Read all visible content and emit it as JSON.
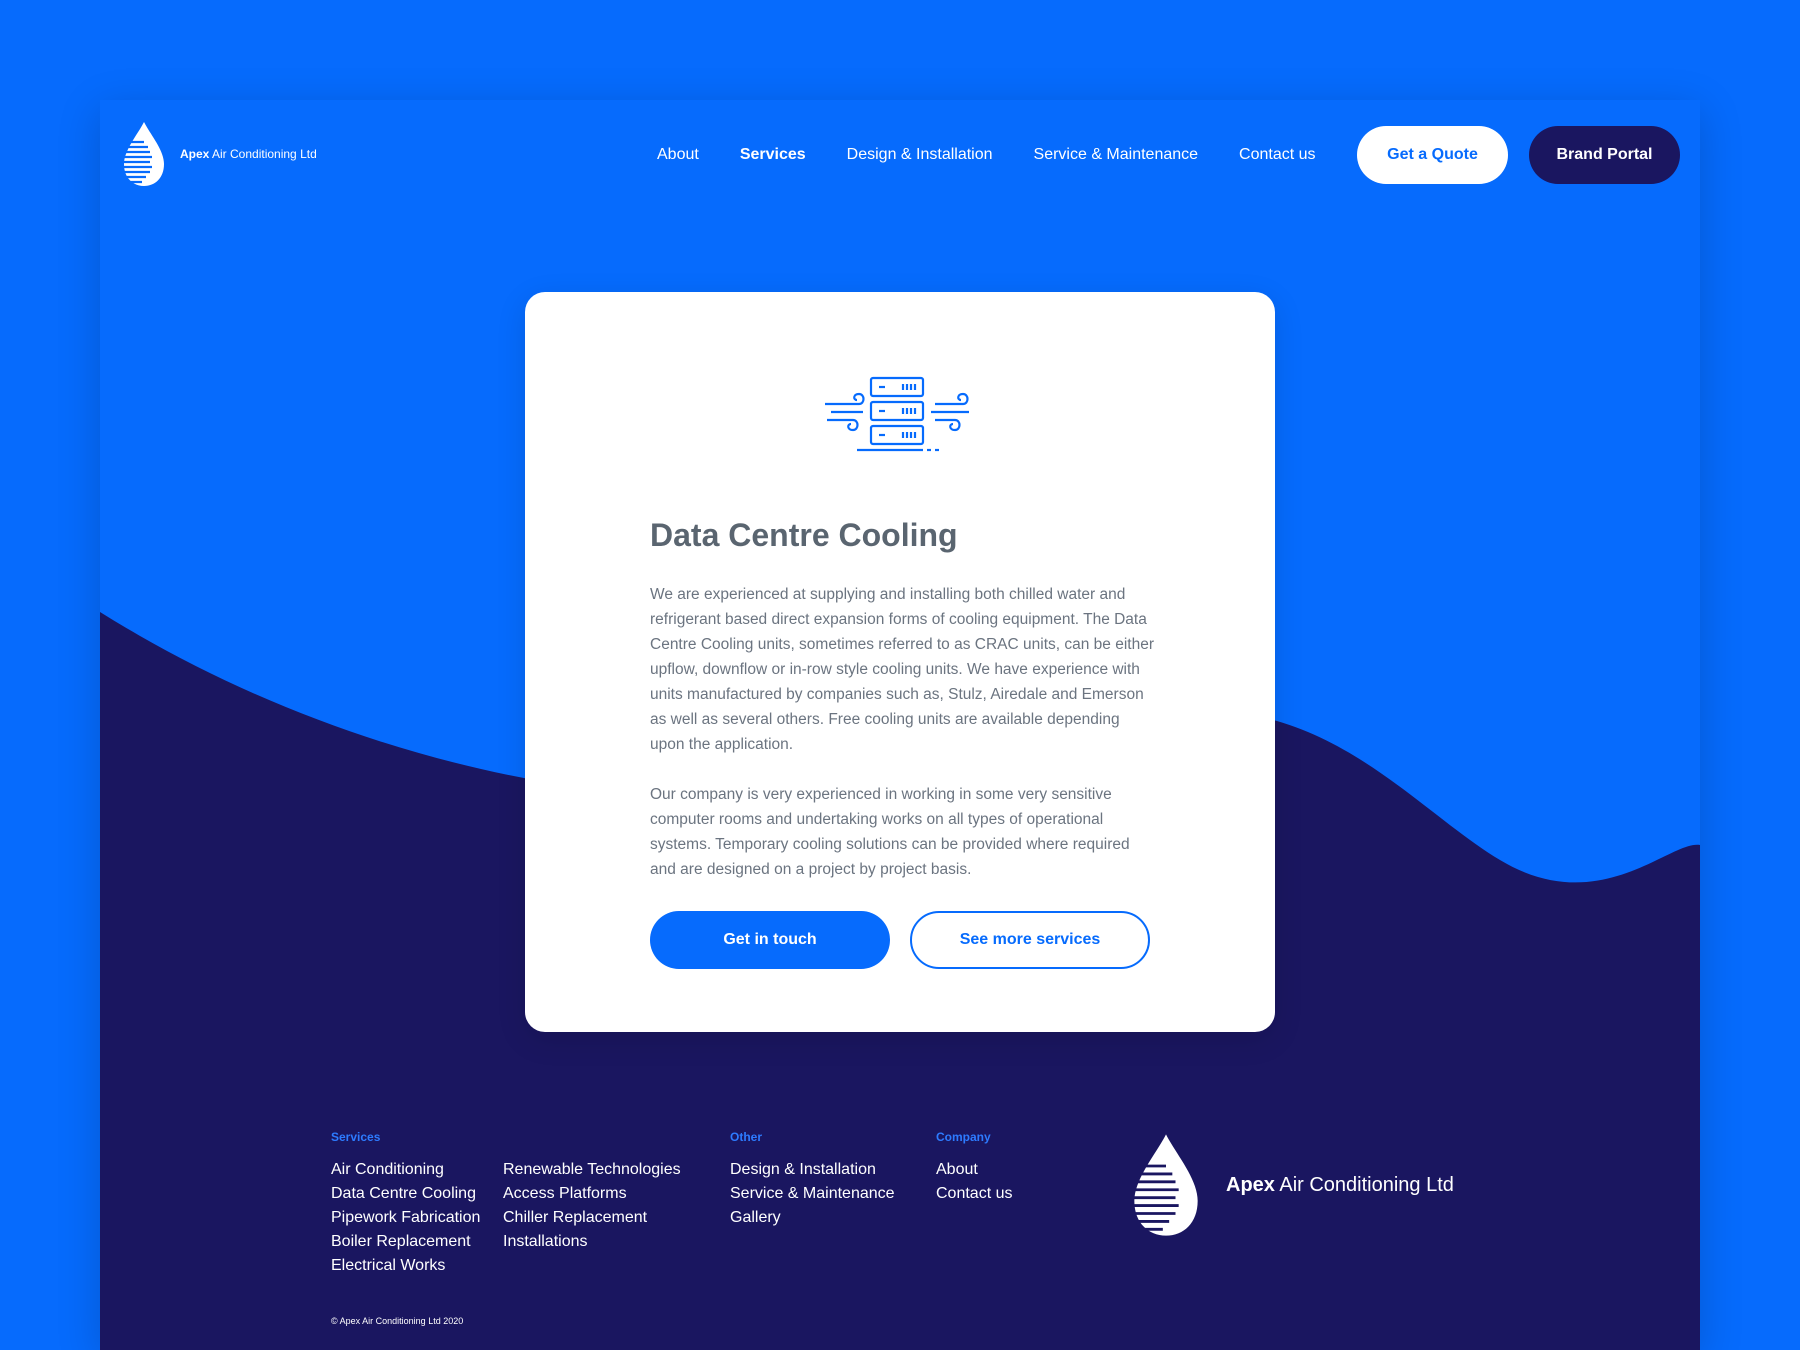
{
  "colors": {
    "primary": "#066bfd",
    "dark": "#1a1660",
    "white": "#ffffff",
    "heading": "#5a6570",
    "body_text": "#6b7480"
  },
  "header": {
    "brand_bold": "Apex",
    "brand_rest": " Air Conditioning Ltd",
    "nav": [
      {
        "label": "About"
      },
      {
        "label": "Services"
      },
      {
        "label": "Design & Installation"
      },
      {
        "label": "Service & Maintenance"
      },
      {
        "label": "Contact us"
      }
    ],
    "quote_button": "Get a Quote",
    "portal_button": "Brand Portal"
  },
  "card": {
    "icon": "server-cooling-icon",
    "title": "Data Centre Cooling",
    "paragraph1": "We are experienced at supplying and installing both chilled water and refrigerant based direct expansion forms of cooling equipment. The Data Centre Cooling units, sometimes referred to as CRAC units, can be either upflow, downflow or in-row style cooling units. We have experience with units manufactured by companies such as, Stulz, Airedale and Emerson as well as several others. Free cooling units are available depending upon the application.",
    "paragraph2": "Our company is very experienced in working in some very sensitive computer rooms and undertaking works on all types of operational systems. Temporary cooling solutions can be provided where required and are designed on a project by project basis.",
    "primary_button": "Get in touch",
    "secondary_button": "See more services"
  },
  "footer": {
    "services_heading": "Services",
    "services_col1": [
      "Air Conditioning",
      "Data Centre Cooling",
      "Pipework Fabrication",
      "Boiler Replacement",
      "Electrical Works"
    ],
    "services_col2": [
      "Renewable Technologies",
      "Access Platforms",
      "Chiller Replacement",
      "Installations"
    ],
    "other_heading": "Other",
    "other_links": [
      "Design & Installation",
      "Service & Maintenance",
      "Gallery"
    ],
    "company_heading": "Company",
    "company_links": [
      "About",
      "Contact us"
    ],
    "brand_bold": "Apex",
    "brand_rest": " Air Conditioning Ltd",
    "copyright": "© Apex Air Conditioning Ltd 2020"
  }
}
